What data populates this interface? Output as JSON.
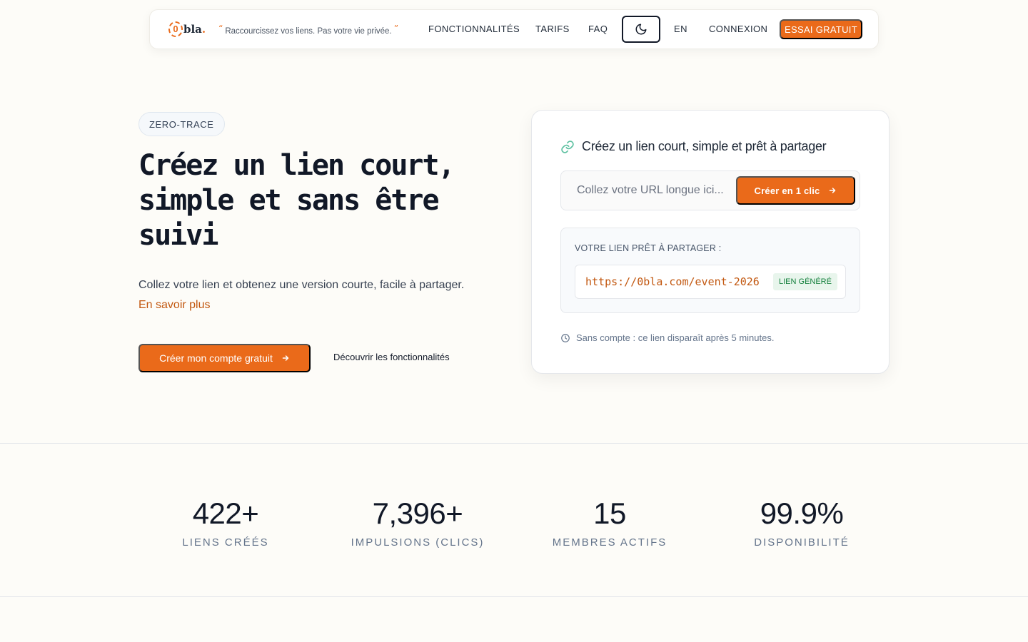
{
  "nav": {
    "logo_mark": "0",
    "logo_text": "bla",
    "logo_dot": ".",
    "tagline_open": "“",
    "tagline": "Raccourcissez vos liens. Pas votre vie privée.",
    "tagline_close": "”",
    "links": {
      "features": "FONCTIONNALITÉS",
      "pricing": "TARIFS",
      "faq": "FAQ",
      "language": "EN",
      "login": "CONNEXION"
    },
    "trial_label": "ESSAI GRATUIT",
    "theme_icon": "moon-icon"
  },
  "hero": {
    "badge": "ZERO-TRACE",
    "title_line1": "Créez un lien court,",
    "title_line2": "simple et sans être",
    "title_line3": "suivi",
    "subtitle": "Collez votre lien et obtenez une version courte, facile à partager.",
    "learn_more": "En savoir plus",
    "cta_label": "Créer mon compte gratuit",
    "features_link": "Découvrir les fonctionnalités"
  },
  "card": {
    "title": "Créez un lien court, simple et prêt à partager",
    "input_placeholder": "Collez votre URL longue ici...",
    "input_value": "",
    "create_label": "Créer en 1 clic",
    "result_label": "VOTRE LIEN PRÊT À PARTAGER :",
    "short_url": "https://0bla.com/event-2026",
    "generated_badge": "LIEN GÉNÉRÉ",
    "expire_note": "Sans compte : ce lien disparaît après 5 minutes."
  },
  "stats": [
    {
      "value": "422+",
      "label": "LIENS CRÉÉS"
    },
    {
      "value": "7,396+",
      "label": "IMPULSIONS (CLICS)"
    },
    {
      "value": "15",
      "label": "MEMBRES ACTIFS"
    },
    {
      "value": "99.9%",
      "label": "DISPONIBILITÉ"
    }
  ],
  "colors": {
    "accent": "#ea6a1a",
    "link_text": "#c2570f",
    "success": "#15803d",
    "background": "#fdfcf8"
  }
}
